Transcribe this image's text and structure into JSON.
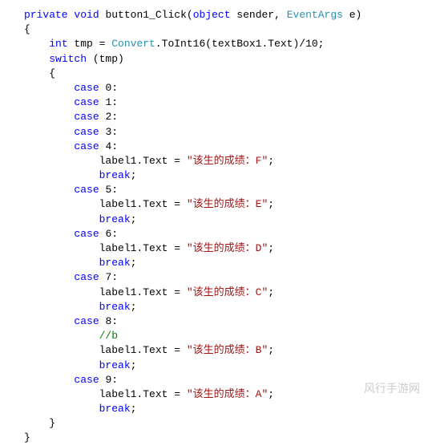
{
  "code": {
    "kw_private": "private",
    "kw_void": "void",
    "method_name": "button1_Click",
    "paren_open": "(",
    "kw_object": "object",
    "param_sender": " sender, ",
    "type_eventargs": "EventArgs",
    "param_e": " e",
    "paren_close": ")",
    "brace_open": "{",
    "brace_close": "}",
    "kw_int": "int",
    "var_tmp": " tmp = ",
    "type_convert": "Convert",
    "toint16": ".ToInt16(textBox1.Text)/10;",
    "kw_switch": "switch",
    "switch_expr": " (tmp)",
    "kw_case": "case",
    "case0": " 0:",
    "case1": " 1:",
    "case2": " 2:",
    "case3": " 3:",
    "case4": " 4:",
    "case5": " 5:",
    "case6": " 6:",
    "case7": " 7:",
    "case8": " 8:",
    "case9": " 9:",
    "label_assign": "label1.Text = ",
    "str_f": "\"该生的成绩：F\"",
    "str_e": "\"该生的成绩：E\"",
    "str_d": "\"该生的成绩：D\"",
    "str_c": "\"该生的成绩：C\"",
    "str_b": "\"该生的成绩：B\"",
    "str_a": "\"该生的成绩：A\"",
    "semicolon": ";",
    "kw_break": "break",
    "comment_b": "//b"
  },
  "watermark": "风行手游网"
}
